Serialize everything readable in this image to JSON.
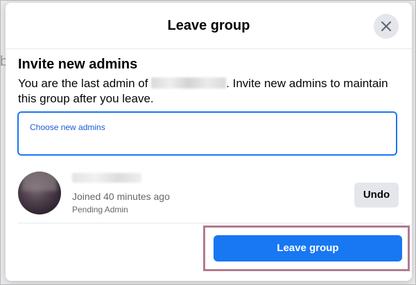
{
  "dialog": {
    "title": "Leave group",
    "close_icon": "close-icon"
  },
  "invite": {
    "title": "Invite new admins",
    "desc_before": "You are the last admin of ",
    "desc_after": ". Invite new admins to maintain this group after you leave.",
    "input_placeholder": "Choose new admins"
  },
  "member": {
    "joined": "Joined 40 minutes ago",
    "status": "Pending Admin",
    "undo_label": "Undo"
  },
  "footer": {
    "leave_label": "Leave group"
  },
  "colors": {
    "accent": "#1877f2",
    "highlight_border": "#b07a8e"
  }
}
